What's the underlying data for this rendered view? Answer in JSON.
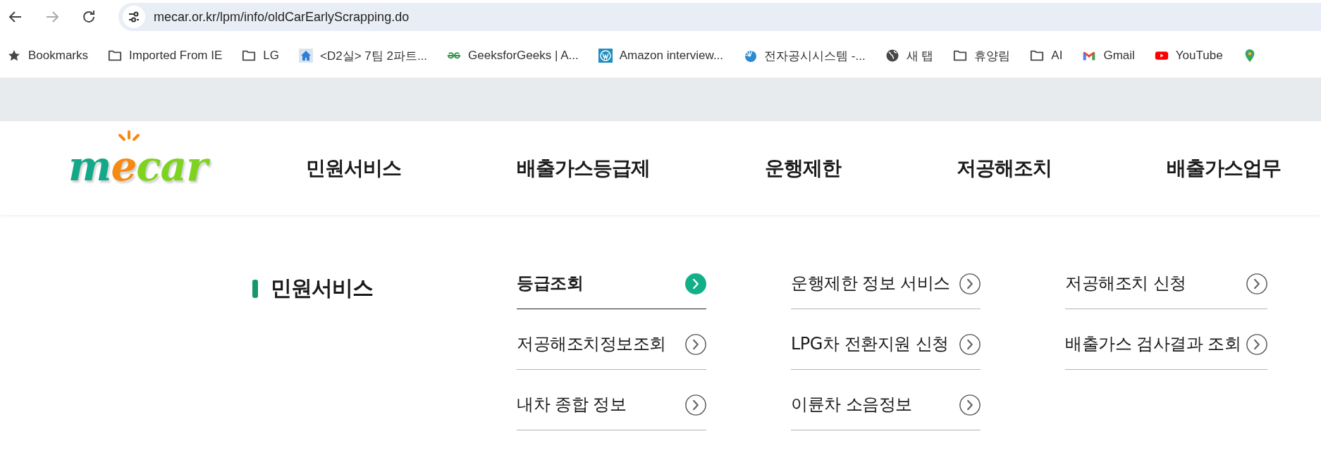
{
  "browser": {
    "url": "mecar.or.kr/lpm/info/oldCarEarlyScrapping.do"
  },
  "bookmarks": [
    {
      "kind": "star",
      "label": "Bookmarks"
    },
    {
      "kind": "folder",
      "label": "Imported From IE"
    },
    {
      "kind": "folder",
      "label": "LG"
    },
    {
      "kind": "home",
      "label": "<D2실> 7팀 2파트..."
    },
    {
      "kind": "geeks",
      "label": "GeeksforGeeks | A..."
    },
    {
      "kind": "wordpress",
      "label": "Amazon interview..."
    },
    {
      "kind": "swirl",
      "label": "전자공시시스템 -..."
    },
    {
      "kind": "globe",
      "label": "새 탭"
    },
    {
      "kind": "folder",
      "label": "휴양림"
    },
    {
      "kind": "folder",
      "label": "AI"
    },
    {
      "kind": "gmail",
      "label": "Gmail"
    },
    {
      "kind": "youtube",
      "label": "YouTube"
    },
    {
      "kind": "pin"
    }
  ],
  "site": {
    "logo": "mecar",
    "nav": [
      "민원서비스",
      "배출가스등급제",
      "운행제한",
      "저공해조치",
      "배출가스업무"
    ],
    "submenu": {
      "title": "민원서비스",
      "columns": [
        [
          {
            "label": "등급조회",
            "selected": true
          },
          {
            "label": "저공해조치정보조회",
            "selected": false
          },
          {
            "label": "내차 종합 정보",
            "selected": false
          }
        ],
        [
          {
            "label": "운행제한 정보 서비스",
            "selected": false
          },
          {
            "label": "LPG차 전환지원 신청",
            "selected": false
          },
          {
            "label": "이륜차 소음정보",
            "selected": false
          }
        ],
        [
          {
            "label": "저공해조치 신청",
            "selected": false
          },
          {
            "label": "배출가스 검사결과 조회",
            "selected": false
          }
        ]
      ]
    }
  }
}
